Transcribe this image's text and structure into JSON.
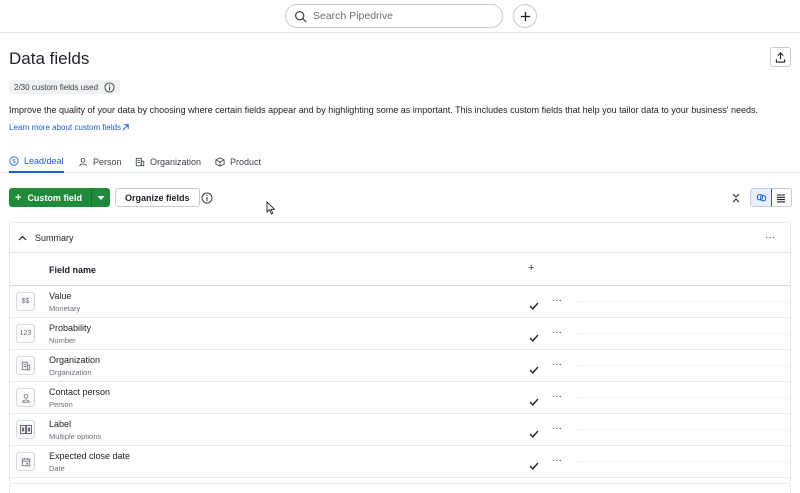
{
  "topbar": {
    "search_placeholder": "Search Pipedrive"
  },
  "header": {
    "title": "Data fields",
    "usage_badge": "2/30 custom fields used",
    "description": "Improve the quality of your data by choosing where certain fields appear and by highlighting some as important. This includes custom fields that help you tailor data to your business' needs.",
    "learn_more": "Learn more about custom fields"
  },
  "tabs": [
    {
      "label": "Lead/deal",
      "icon": "dollar-circle-icon",
      "active": true
    },
    {
      "label": "Person",
      "icon": "person-icon",
      "active": false
    },
    {
      "label": "Organization",
      "icon": "building-icon",
      "active": false
    },
    {
      "label": "Product",
      "icon": "box-icon",
      "active": false
    }
  ],
  "toolbar": {
    "custom_field_label": "Custom field",
    "organize_label": "Organize fields"
  },
  "section": {
    "title": "Summary",
    "column_header": "Field name"
  },
  "fields": [
    {
      "name": "Value",
      "type": "Monetary",
      "icon": "monetary-icon",
      "icon_text": "$$"
    },
    {
      "name": "Probability",
      "type": "Number",
      "icon": "number-icon",
      "icon_text": "123"
    },
    {
      "name": "Organization",
      "type": "Organization",
      "icon": "organization-icon",
      "icon_text": ""
    },
    {
      "name": "Contact person",
      "type": "Person",
      "icon": "person-icon",
      "icon_text": ""
    },
    {
      "name": "Label",
      "type": "Multiple options",
      "icon": "multiple-options-icon",
      "icon_text": ""
    },
    {
      "name": "Expected close date",
      "type": "Date",
      "icon": "calendar-icon",
      "icon_text": ""
    }
  ],
  "colors": {
    "primary": "#1f8a3c",
    "link": "#1a5bd7",
    "border": "#e5e7eb"
  }
}
